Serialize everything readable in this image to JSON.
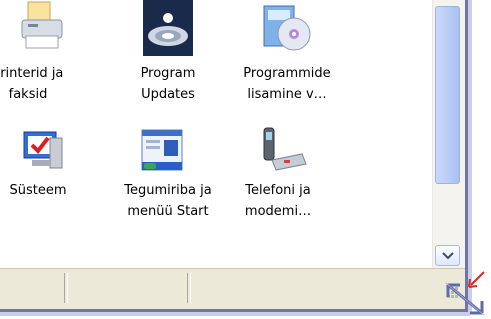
{
  "icons": [
    {
      "id": "printers",
      "label": "Printerid ja\nfaksid",
      "icon": "printer-icon"
    },
    {
      "id": "program-updates",
      "label": "Program\nUpdates",
      "icon": "program-updates-icon"
    },
    {
      "id": "add-remove",
      "label": "Programmide\nlisamine v…",
      "icon": "add-remove-programs-icon"
    },
    {
      "id": "system",
      "label": "Süsteem",
      "icon": "system-icon"
    },
    {
      "id": "taskbar",
      "label": "Tegumiriba ja\nmenüü Start",
      "icon": "taskbar-start-menu-icon"
    },
    {
      "id": "phone-modem",
      "label": "Telefoni ja\nmodemi…",
      "icon": "phone-modem-icon"
    }
  ],
  "colors": {
    "frame": "#6f75a8",
    "frame_highlight": "#c9cde8",
    "resize_arrow": "#d62a1e",
    "resize_glyph": "#5f6aa6"
  }
}
